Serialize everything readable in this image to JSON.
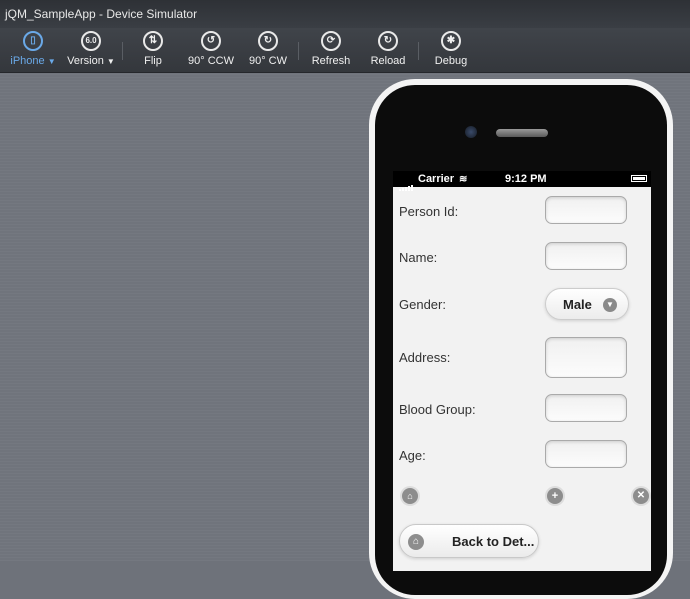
{
  "window": {
    "title": "jQM_SampleApp - Device Simulator"
  },
  "toolbar": {
    "device_label": "iPhone",
    "version_label": "Version",
    "version_icon_text": "6.0",
    "flip_label": "Flip",
    "ccw_label": "90° CCW",
    "cw_label": "90° CW",
    "refresh_label": "Refresh",
    "reload_label": "Reload",
    "debug_label": "Debug"
  },
  "statusbar": {
    "carrier": "Carrier",
    "time": "9:12 PM"
  },
  "form": {
    "person_id_label": "Person Id:",
    "name_label": "Name:",
    "gender_label": "Gender:",
    "gender_value": "Male",
    "address_label": "Address:",
    "blood_group_label": "Blood Group:",
    "age_label": "Age:"
  },
  "footer": {
    "back_button_label": "Back to Det..."
  },
  "colors": {
    "accent": "#6aa9e8"
  }
}
